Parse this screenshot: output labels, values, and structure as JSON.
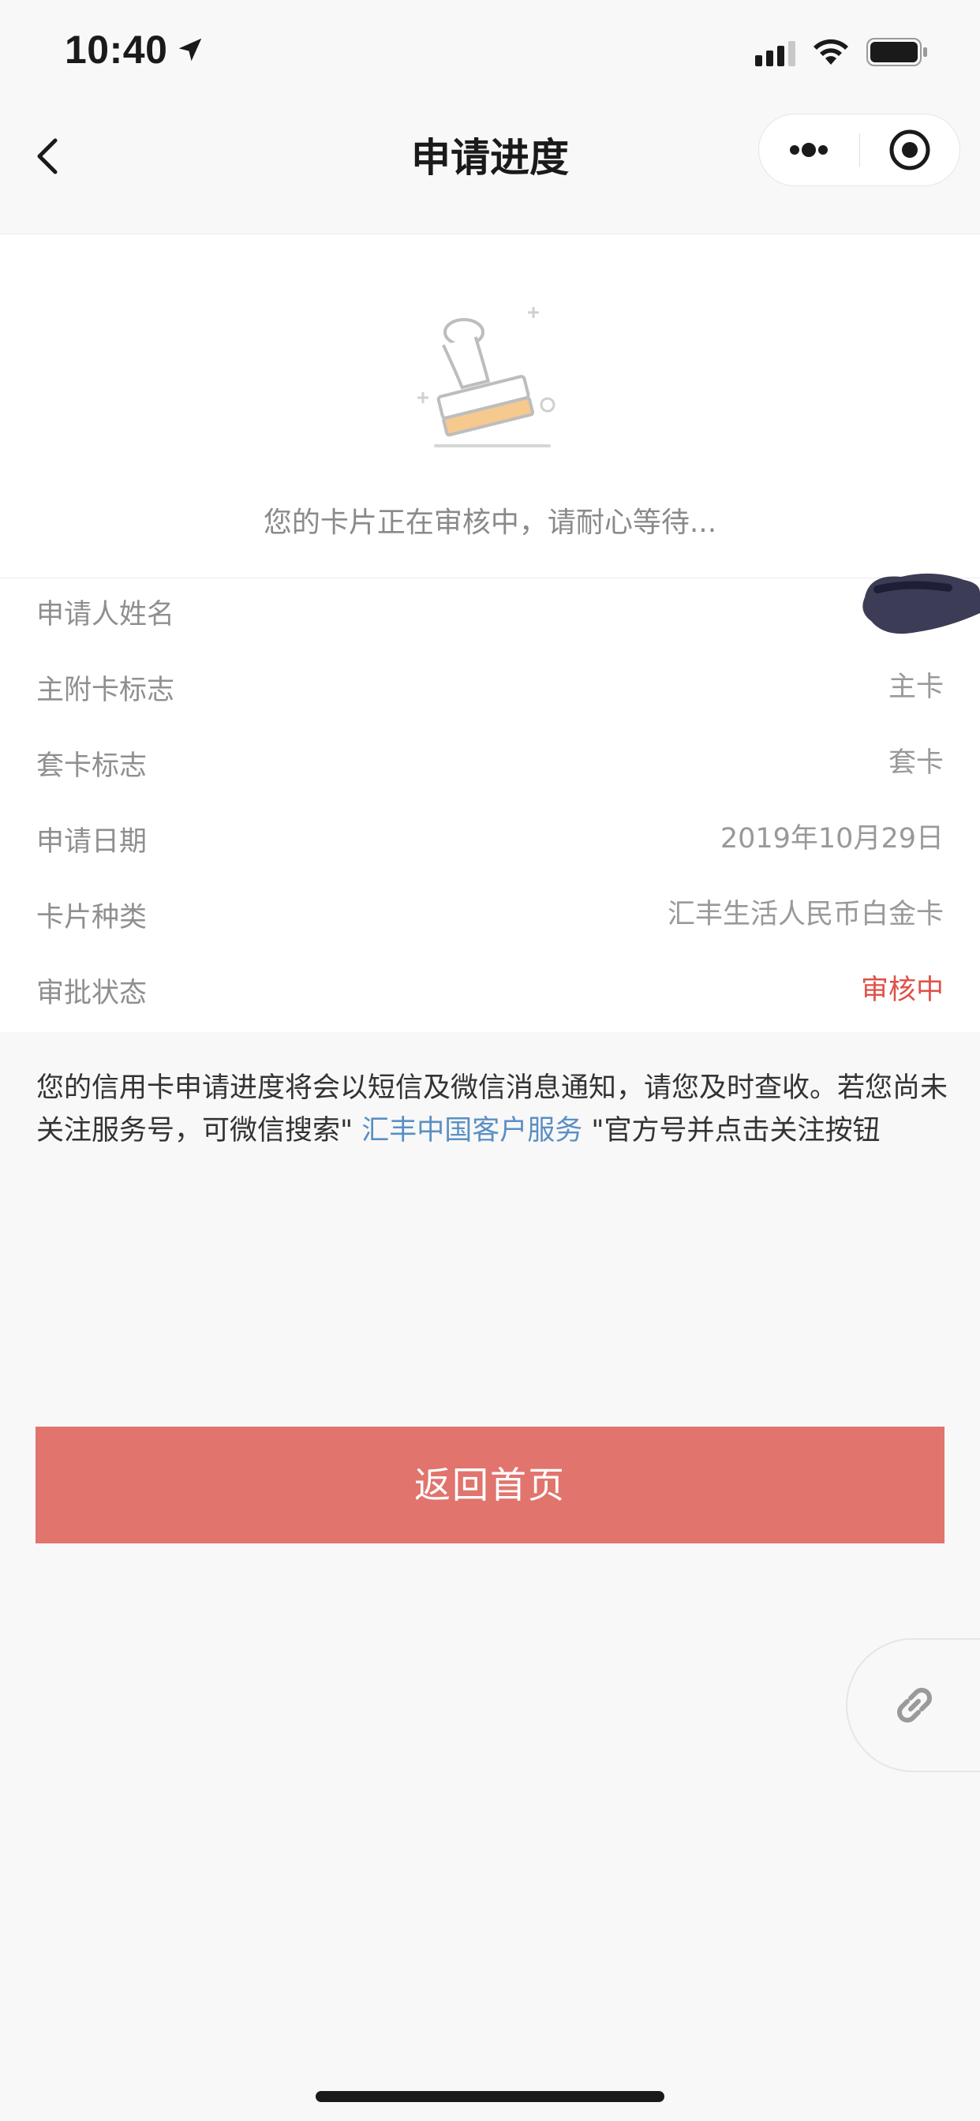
{
  "status_bar": {
    "time": "10:40"
  },
  "nav": {
    "title": "申请进度",
    "icons": {
      "back": "chevron-left-icon",
      "more": "more-dots-icon",
      "close": "mini-program-close-icon"
    }
  },
  "review": {
    "icon": "stamp-icon",
    "message": "您的卡片正在审核中，请耐心等待..."
  },
  "info": {
    "rows": [
      {
        "label": "申请人姓名",
        "value": ""
      },
      {
        "label": "主附卡标志",
        "value": "主卡"
      },
      {
        "label": "套卡标志",
        "value": "套卡"
      },
      {
        "label": "申请日期",
        "value": "2019年10月29日"
      },
      {
        "label": "卡片种类",
        "value": "汇丰生活人民币白金卡"
      },
      {
        "label": "审批状态",
        "value": "审核中"
      }
    ]
  },
  "notice": {
    "before_link": "您的信用卡申请进度将会以短信及微信消息通知，请您及时查收。若您尚未关注服务号，可微信搜索\"",
    "link": " 汇丰中国客户服务 ",
    "after_link": "\"官方号并点击关注按钮"
  },
  "actions": {
    "home_button": "返回首页",
    "float_icon": "link-icon"
  },
  "colors": {
    "accent_button": "#e1746d",
    "status_pending": "#e0504a",
    "link": "#5a8fc4",
    "background": "#f8f8f8"
  }
}
